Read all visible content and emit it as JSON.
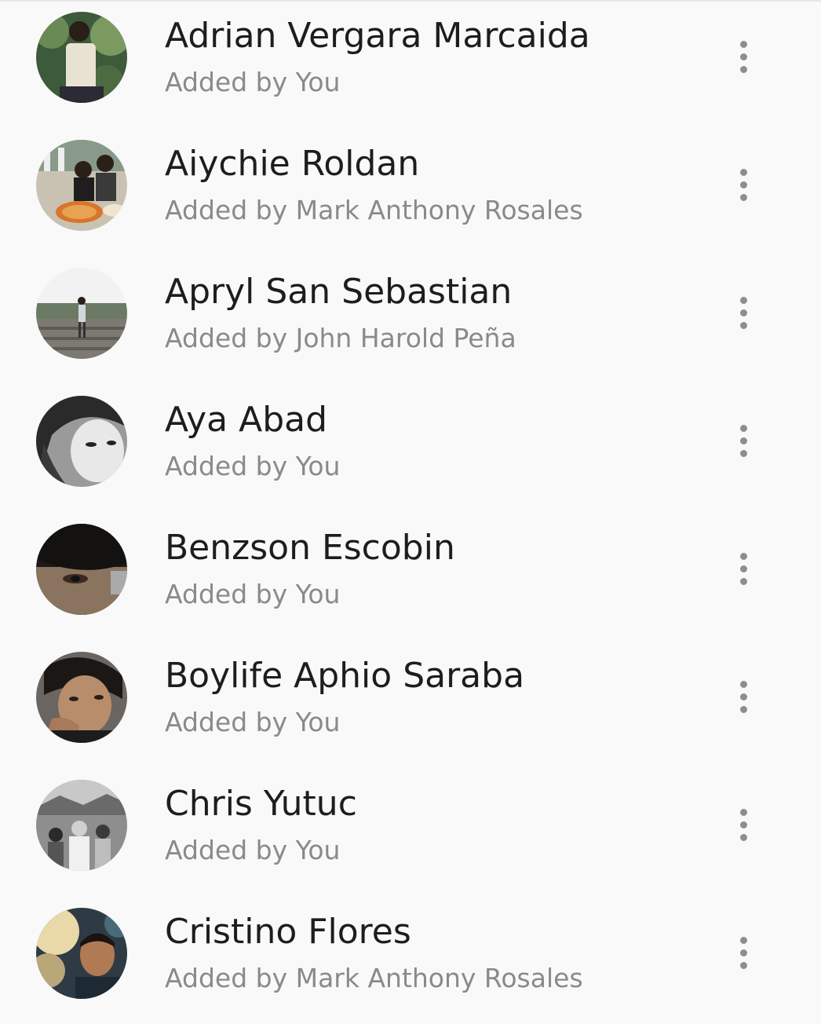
{
  "members": [
    {
      "name": "Adrian Vergara Marcaida",
      "added_by": "Added by You",
      "avatar": "avatar-photo"
    },
    {
      "name": "Aiychie Roldan",
      "added_by": "Added by Mark Anthony Rosales",
      "avatar": "avatar-photo"
    },
    {
      "name": "Apryl San Sebastian",
      "added_by": "Added by John Harold Peña",
      "avatar": "avatar-photo"
    },
    {
      "name": "Aya Abad",
      "added_by": "Added by You",
      "avatar": "avatar-photo"
    },
    {
      "name": "Benzson Escobin",
      "added_by": "Added by You",
      "avatar": "avatar-photo"
    },
    {
      "name": "Boylife Aphio Saraba",
      "added_by": "Added by You",
      "avatar": "avatar-photo"
    },
    {
      "name": "Chris Yutuc",
      "added_by": "Added by You",
      "avatar": "avatar-photo"
    },
    {
      "name": "Cristino Flores",
      "added_by": "Added by Mark Anthony Rosales",
      "avatar": "avatar-photo"
    }
  ],
  "icons": {
    "more": "more-vertical-icon"
  },
  "colors": {
    "background": "#f9f9f9",
    "name_text": "#1d1d1d",
    "secondary_text": "#8a8a8a",
    "more_icon": "#8d8d8d"
  }
}
